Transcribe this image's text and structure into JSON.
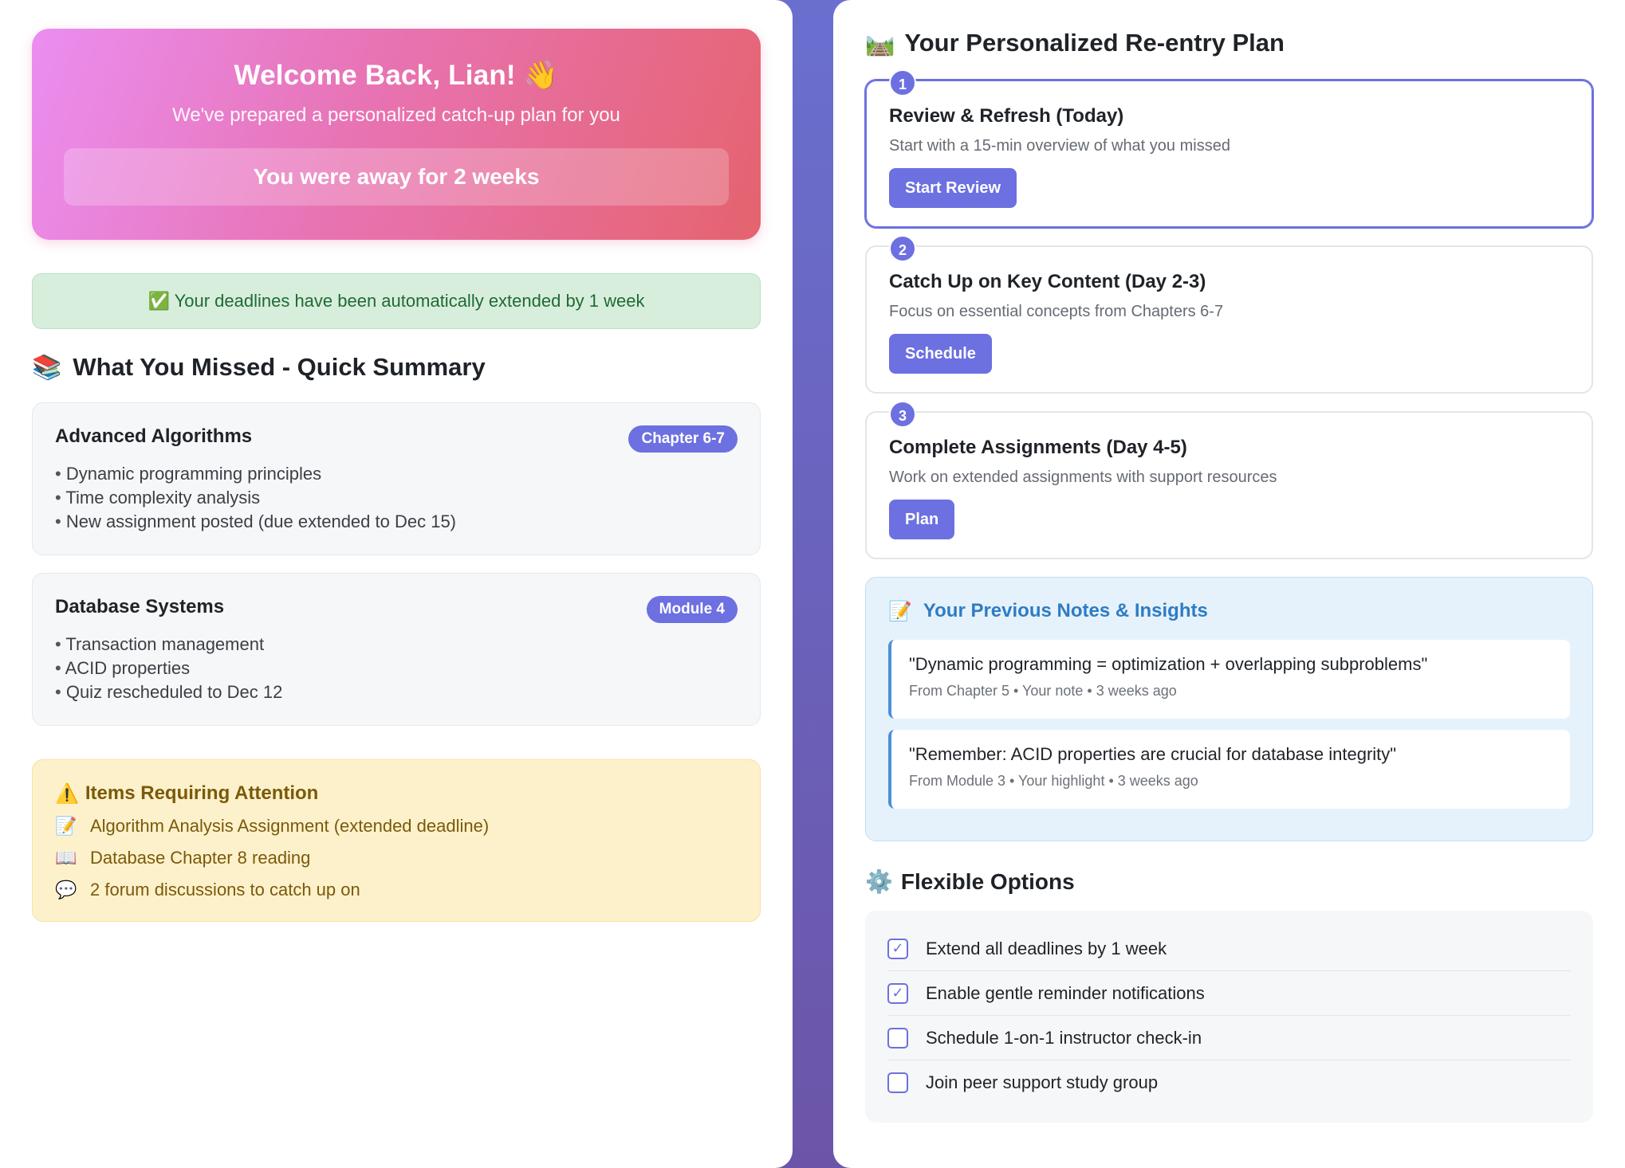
{
  "welcome": {
    "title": "Welcome Back, Lian! 👋",
    "subtitle": "We've prepared a personalized catch-up plan for you",
    "away_text": "You were away for 2 weeks"
  },
  "notice": {
    "icon": "check-icon",
    "text": "✅ Your deadlines have been automatically extended by 1 week"
  },
  "summary": {
    "icon": "books-icon",
    "title": "What You Missed - Quick Summary",
    "courses": [
      {
        "name": "Advanced Algorithms",
        "badge": "Chapter 6-7",
        "items": [
          "Dynamic programming principles",
          "Time complexity analysis",
          "New assignment posted (due extended to Dec 15)"
        ]
      },
      {
        "name": "Database Systems",
        "badge": "Module 4",
        "items": [
          "Transaction management",
          "ACID properties",
          "Quiz rescheduled to Dec 12"
        ]
      }
    ]
  },
  "attention": {
    "title": "Items Requiring Attention",
    "items": [
      {
        "icon": "memo-icon",
        "glyph": "📝",
        "text": "Algorithm Analysis Assignment (extended deadline)"
      },
      {
        "icon": "book-icon",
        "glyph": "📖",
        "text": "Database Chapter 8 reading"
      },
      {
        "icon": "speech-bubble-icon",
        "glyph": "💬",
        "text": "2 forum discussions to catch up on"
      }
    ]
  },
  "plan": {
    "icon": "railway-track-icon",
    "title": "Your Personalized Re-entry Plan",
    "steps": [
      {
        "num": "1",
        "title": "Review & Refresh (Today)",
        "desc": "Start with a 15-min overview of what you missed",
        "button": "Start Review"
      },
      {
        "num": "2",
        "title": "Catch Up on Key Content (Day 2-3)",
        "desc": "Focus on essential concepts from Chapters 6-7",
        "button": "Schedule"
      },
      {
        "num": "3",
        "title": "Complete Assignments (Day 4-5)",
        "desc": "Work on extended assignments with support resources",
        "button": "Plan"
      }
    ]
  },
  "notes": {
    "icon": "memo-icon",
    "title": "Your Previous Notes & Insights",
    "items": [
      {
        "quote": "\"Dynamic programming = optimization + overlapping subproblems\"",
        "meta": "From Chapter 5 • Your note • 3 weeks ago"
      },
      {
        "quote": "\"Remember: ACID properties are crucial for database integrity\"",
        "meta": "From Module 3 • Your highlight • 3 weeks ago"
      }
    ]
  },
  "options": {
    "icon": "gear-icon",
    "title": "Flexible Options",
    "items": [
      {
        "label": "Extend all deadlines by 1 week",
        "checked": true
      },
      {
        "label": "Enable gentle reminder notifications",
        "checked": true
      },
      {
        "label": "Schedule 1-on-1 instructor check-in",
        "checked": false
      },
      {
        "label": "Join peer support study group",
        "checked": false
      }
    ]
  },
  "colors": {
    "accent": "#6c70e0",
    "background": "#6a6fcf"
  }
}
